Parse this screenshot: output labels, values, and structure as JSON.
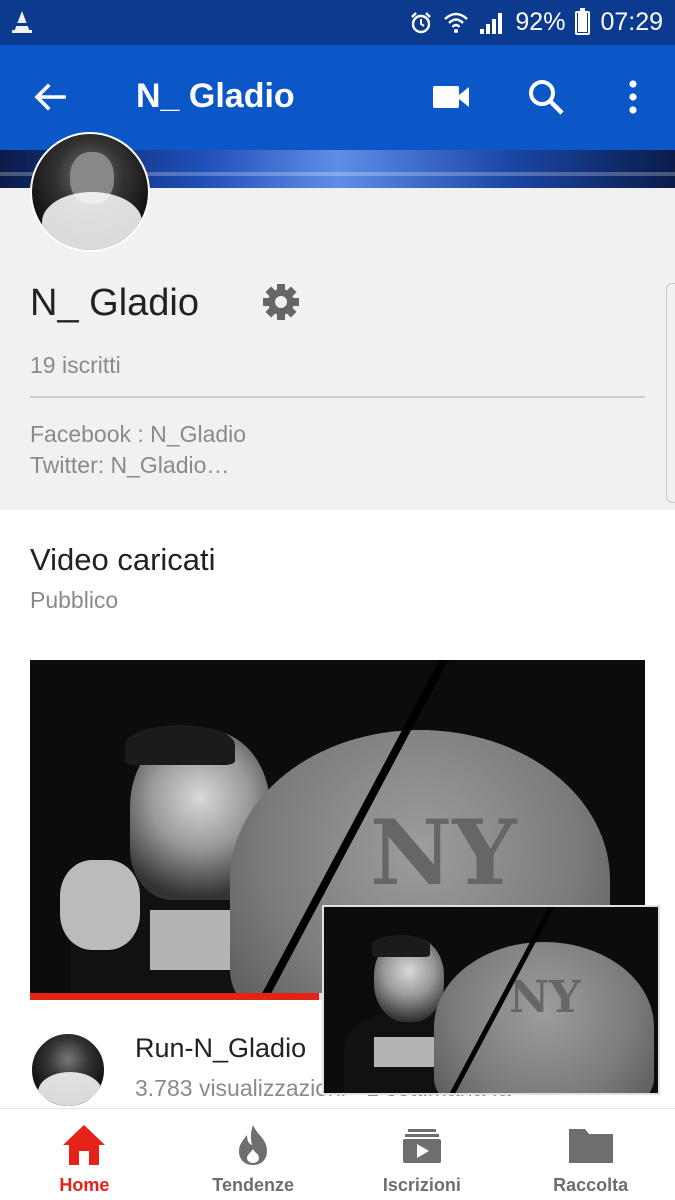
{
  "status_bar": {
    "battery": "92%",
    "battery_level": 0.92,
    "time": "07:29",
    "icons": [
      "vlc-icon",
      "alarm-icon",
      "wifi-icon",
      "signal-icon",
      "battery-icon"
    ]
  },
  "app_bar": {
    "title": "N_ Gladio",
    "icons": [
      "back-arrow-icon",
      "video-camera-icon",
      "search-icon",
      "more-vert-icon"
    ]
  },
  "channel": {
    "name": "N_ Gladio",
    "subscribers": "19 iscritti",
    "description_line1": "Facebook : N_Gladio",
    "description_line2": "Twitter: N_Gladio…"
  },
  "uploads": {
    "title": "Video caricati",
    "visibility": "Pubblico",
    "videos": [
      {
        "title": "Run-N_Gladio",
        "meta": "3.783 visualizzazioni · 1 settimana fa",
        "watched_progress": 0.47,
        "thumbnail_text": "NY"
      }
    ]
  },
  "bottom_nav": {
    "items": [
      {
        "label": "Home",
        "icon": "home-icon",
        "active": true
      },
      {
        "label": "Tendenze",
        "icon": "trending-flame-icon",
        "active": false
      },
      {
        "label": "Iscrizioni",
        "icon": "subscriptions-icon",
        "active": false
      },
      {
        "label": "Raccolta",
        "icon": "library-folder-icon",
        "active": false
      }
    ]
  },
  "colors": {
    "status_bar": "#0B3A8F",
    "app_bar": "#0B57C8",
    "accent_red": "#E62117",
    "header_bg": "#F1F1F1"
  }
}
